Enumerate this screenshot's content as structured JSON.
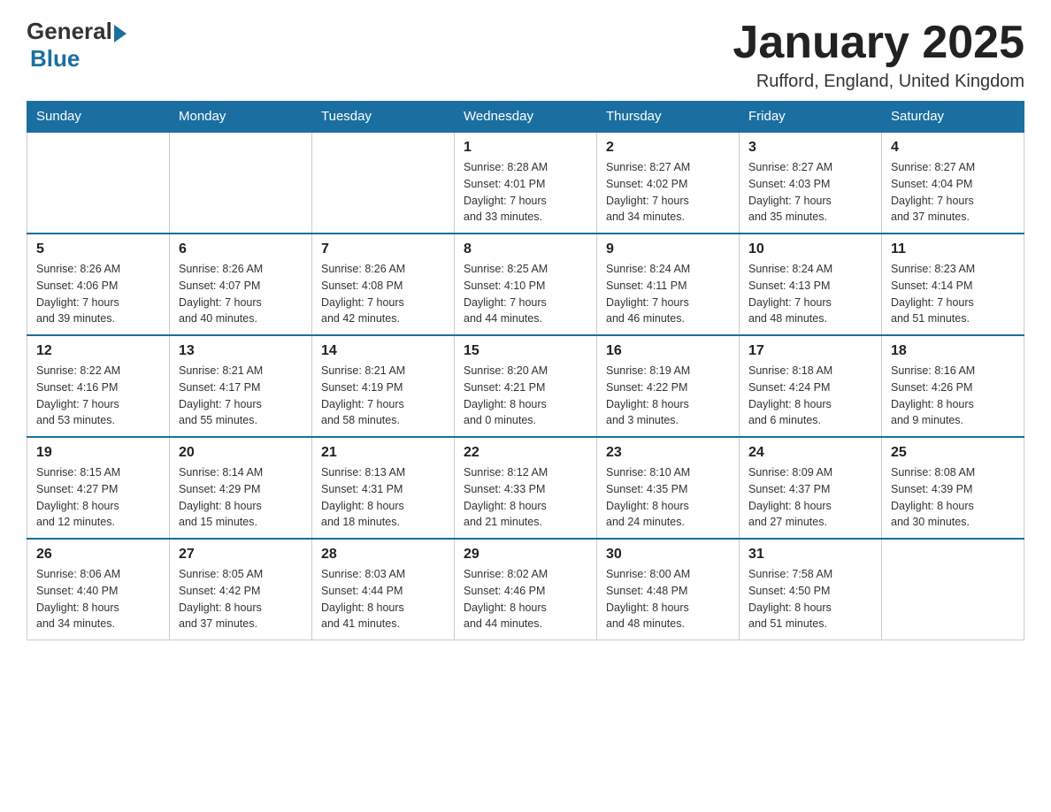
{
  "header": {
    "logo_general": "General",
    "logo_blue": "Blue",
    "title": "January 2025",
    "location": "Rufford, England, United Kingdom"
  },
  "days_of_week": [
    "Sunday",
    "Monday",
    "Tuesday",
    "Wednesday",
    "Thursday",
    "Friday",
    "Saturday"
  ],
  "weeks": [
    [
      {
        "day": "",
        "info": ""
      },
      {
        "day": "",
        "info": ""
      },
      {
        "day": "",
        "info": ""
      },
      {
        "day": "1",
        "info": "Sunrise: 8:28 AM\nSunset: 4:01 PM\nDaylight: 7 hours\nand 33 minutes."
      },
      {
        "day": "2",
        "info": "Sunrise: 8:27 AM\nSunset: 4:02 PM\nDaylight: 7 hours\nand 34 minutes."
      },
      {
        "day": "3",
        "info": "Sunrise: 8:27 AM\nSunset: 4:03 PM\nDaylight: 7 hours\nand 35 minutes."
      },
      {
        "day": "4",
        "info": "Sunrise: 8:27 AM\nSunset: 4:04 PM\nDaylight: 7 hours\nand 37 minutes."
      }
    ],
    [
      {
        "day": "5",
        "info": "Sunrise: 8:26 AM\nSunset: 4:06 PM\nDaylight: 7 hours\nand 39 minutes."
      },
      {
        "day": "6",
        "info": "Sunrise: 8:26 AM\nSunset: 4:07 PM\nDaylight: 7 hours\nand 40 minutes."
      },
      {
        "day": "7",
        "info": "Sunrise: 8:26 AM\nSunset: 4:08 PM\nDaylight: 7 hours\nand 42 minutes."
      },
      {
        "day": "8",
        "info": "Sunrise: 8:25 AM\nSunset: 4:10 PM\nDaylight: 7 hours\nand 44 minutes."
      },
      {
        "day": "9",
        "info": "Sunrise: 8:24 AM\nSunset: 4:11 PM\nDaylight: 7 hours\nand 46 minutes."
      },
      {
        "day": "10",
        "info": "Sunrise: 8:24 AM\nSunset: 4:13 PM\nDaylight: 7 hours\nand 48 minutes."
      },
      {
        "day": "11",
        "info": "Sunrise: 8:23 AM\nSunset: 4:14 PM\nDaylight: 7 hours\nand 51 minutes."
      }
    ],
    [
      {
        "day": "12",
        "info": "Sunrise: 8:22 AM\nSunset: 4:16 PM\nDaylight: 7 hours\nand 53 minutes."
      },
      {
        "day": "13",
        "info": "Sunrise: 8:21 AM\nSunset: 4:17 PM\nDaylight: 7 hours\nand 55 minutes."
      },
      {
        "day": "14",
        "info": "Sunrise: 8:21 AM\nSunset: 4:19 PM\nDaylight: 7 hours\nand 58 minutes."
      },
      {
        "day": "15",
        "info": "Sunrise: 8:20 AM\nSunset: 4:21 PM\nDaylight: 8 hours\nand 0 minutes."
      },
      {
        "day": "16",
        "info": "Sunrise: 8:19 AM\nSunset: 4:22 PM\nDaylight: 8 hours\nand 3 minutes."
      },
      {
        "day": "17",
        "info": "Sunrise: 8:18 AM\nSunset: 4:24 PM\nDaylight: 8 hours\nand 6 minutes."
      },
      {
        "day": "18",
        "info": "Sunrise: 8:16 AM\nSunset: 4:26 PM\nDaylight: 8 hours\nand 9 minutes."
      }
    ],
    [
      {
        "day": "19",
        "info": "Sunrise: 8:15 AM\nSunset: 4:27 PM\nDaylight: 8 hours\nand 12 minutes."
      },
      {
        "day": "20",
        "info": "Sunrise: 8:14 AM\nSunset: 4:29 PM\nDaylight: 8 hours\nand 15 minutes."
      },
      {
        "day": "21",
        "info": "Sunrise: 8:13 AM\nSunset: 4:31 PM\nDaylight: 8 hours\nand 18 minutes."
      },
      {
        "day": "22",
        "info": "Sunrise: 8:12 AM\nSunset: 4:33 PM\nDaylight: 8 hours\nand 21 minutes."
      },
      {
        "day": "23",
        "info": "Sunrise: 8:10 AM\nSunset: 4:35 PM\nDaylight: 8 hours\nand 24 minutes."
      },
      {
        "day": "24",
        "info": "Sunrise: 8:09 AM\nSunset: 4:37 PM\nDaylight: 8 hours\nand 27 minutes."
      },
      {
        "day": "25",
        "info": "Sunrise: 8:08 AM\nSunset: 4:39 PM\nDaylight: 8 hours\nand 30 minutes."
      }
    ],
    [
      {
        "day": "26",
        "info": "Sunrise: 8:06 AM\nSunset: 4:40 PM\nDaylight: 8 hours\nand 34 minutes."
      },
      {
        "day": "27",
        "info": "Sunrise: 8:05 AM\nSunset: 4:42 PM\nDaylight: 8 hours\nand 37 minutes."
      },
      {
        "day": "28",
        "info": "Sunrise: 8:03 AM\nSunset: 4:44 PM\nDaylight: 8 hours\nand 41 minutes."
      },
      {
        "day": "29",
        "info": "Sunrise: 8:02 AM\nSunset: 4:46 PM\nDaylight: 8 hours\nand 44 minutes."
      },
      {
        "day": "30",
        "info": "Sunrise: 8:00 AM\nSunset: 4:48 PM\nDaylight: 8 hours\nand 48 minutes."
      },
      {
        "day": "31",
        "info": "Sunrise: 7:58 AM\nSunset: 4:50 PM\nDaylight: 8 hours\nand 51 minutes."
      },
      {
        "day": "",
        "info": ""
      }
    ]
  ]
}
